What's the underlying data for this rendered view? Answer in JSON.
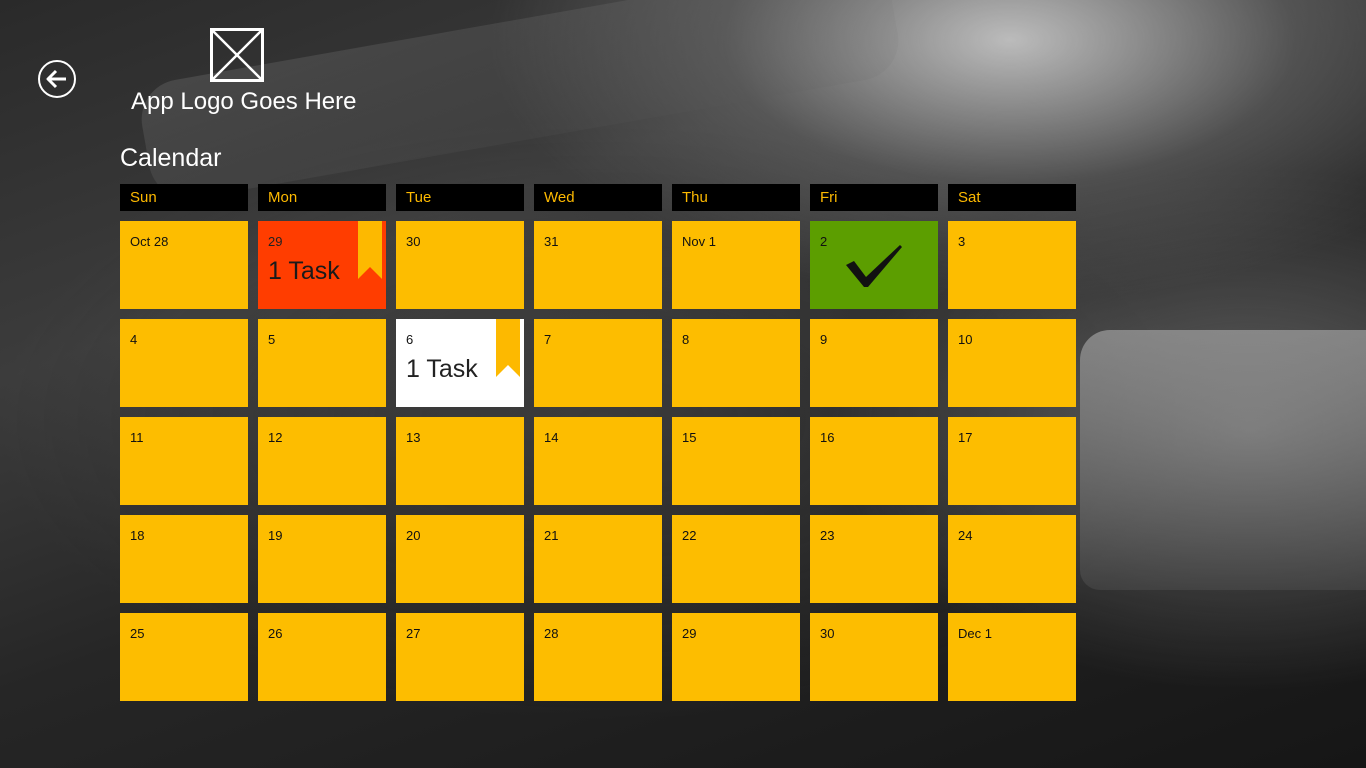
{
  "app": {
    "logo_text": "App Logo Goes Here",
    "page_title": "Calendar",
    "back_icon": "back-arrow-icon",
    "logo_icon": "placeholder-logo-icon"
  },
  "colors": {
    "accent": "#FDB900",
    "cell_default": "#FDBD00",
    "cell_task_red": "#FF3D00",
    "cell_task_white": "#FFFFFF",
    "cell_done": "#5C9E00",
    "header_bg": "#000000"
  },
  "calendar": {
    "weekdays": [
      "Sun",
      "Mon",
      "Tue",
      "Wed",
      "Thu",
      "Fri",
      "Sat"
    ],
    "weeks": [
      [
        {
          "date": "Oct 28",
          "state": "default"
        },
        {
          "date": "29",
          "state": "task-red",
          "task": "1 Task"
        },
        {
          "date": "30",
          "state": "default"
        },
        {
          "date": "31",
          "state": "default"
        },
        {
          "date": "Nov 1",
          "state": "default"
        },
        {
          "date": "2",
          "state": "done"
        },
        {
          "date": "3",
          "state": "default"
        }
      ],
      [
        {
          "date": "4",
          "state": "default"
        },
        {
          "date": "5",
          "state": "default"
        },
        {
          "date": "6",
          "state": "task-white",
          "task": "1 Task"
        },
        {
          "date": "7",
          "state": "default"
        },
        {
          "date": "8",
          "state": "default"
        },
        {
          "date": "9",
          "state": "default"
        },
        {
          "date": "10",
          "state": "default"
        }
      ],
      [
        {
          "date": "11",
          "state": "default"
        },
        {
          "date": "12",
          "state": "default"
        },
        {
          "date": "13",
          "state": "default"
        },
        {
          "date": "14",
          "state": "default"
        },
        {
          "date": "15",
          "state": "default"
        },
        {
          "date": "16",
          "state": "default"
        },
        {
          "date": "17",
          "state": "default"
        }
      ],
      [
        {
          "date": "18",
          "state": "default"
        },
        {
          "date": "19",
          "state": "default"
        },
        {
          "date": "20",
          "state": "default"
        },
        {
          "date": "21",
          "state": "default"
        },
        {
          "date": "22",
          "state": "default"
        },
        {
          "date": "23",
          "state": "default"
        },
        {
          "date": "24",
          "state": "default"
        }
      ],
      [
        {
          "date": "25",
          "state": "default"
        },
        {
          "date": "26",
          "state": "default"
        },
        {
          "date": "27",
          "state": "default"
        },
        {
          "date": "28",
          "state": "default"
        },
        {
          "date": "29",
          "state": "default"
        },
        {
          "date": "30",
          "state": "default"
        },
        {
          "date": "Dec 1",
          "state": "default"
        }
      ]
    ]
  }
}
